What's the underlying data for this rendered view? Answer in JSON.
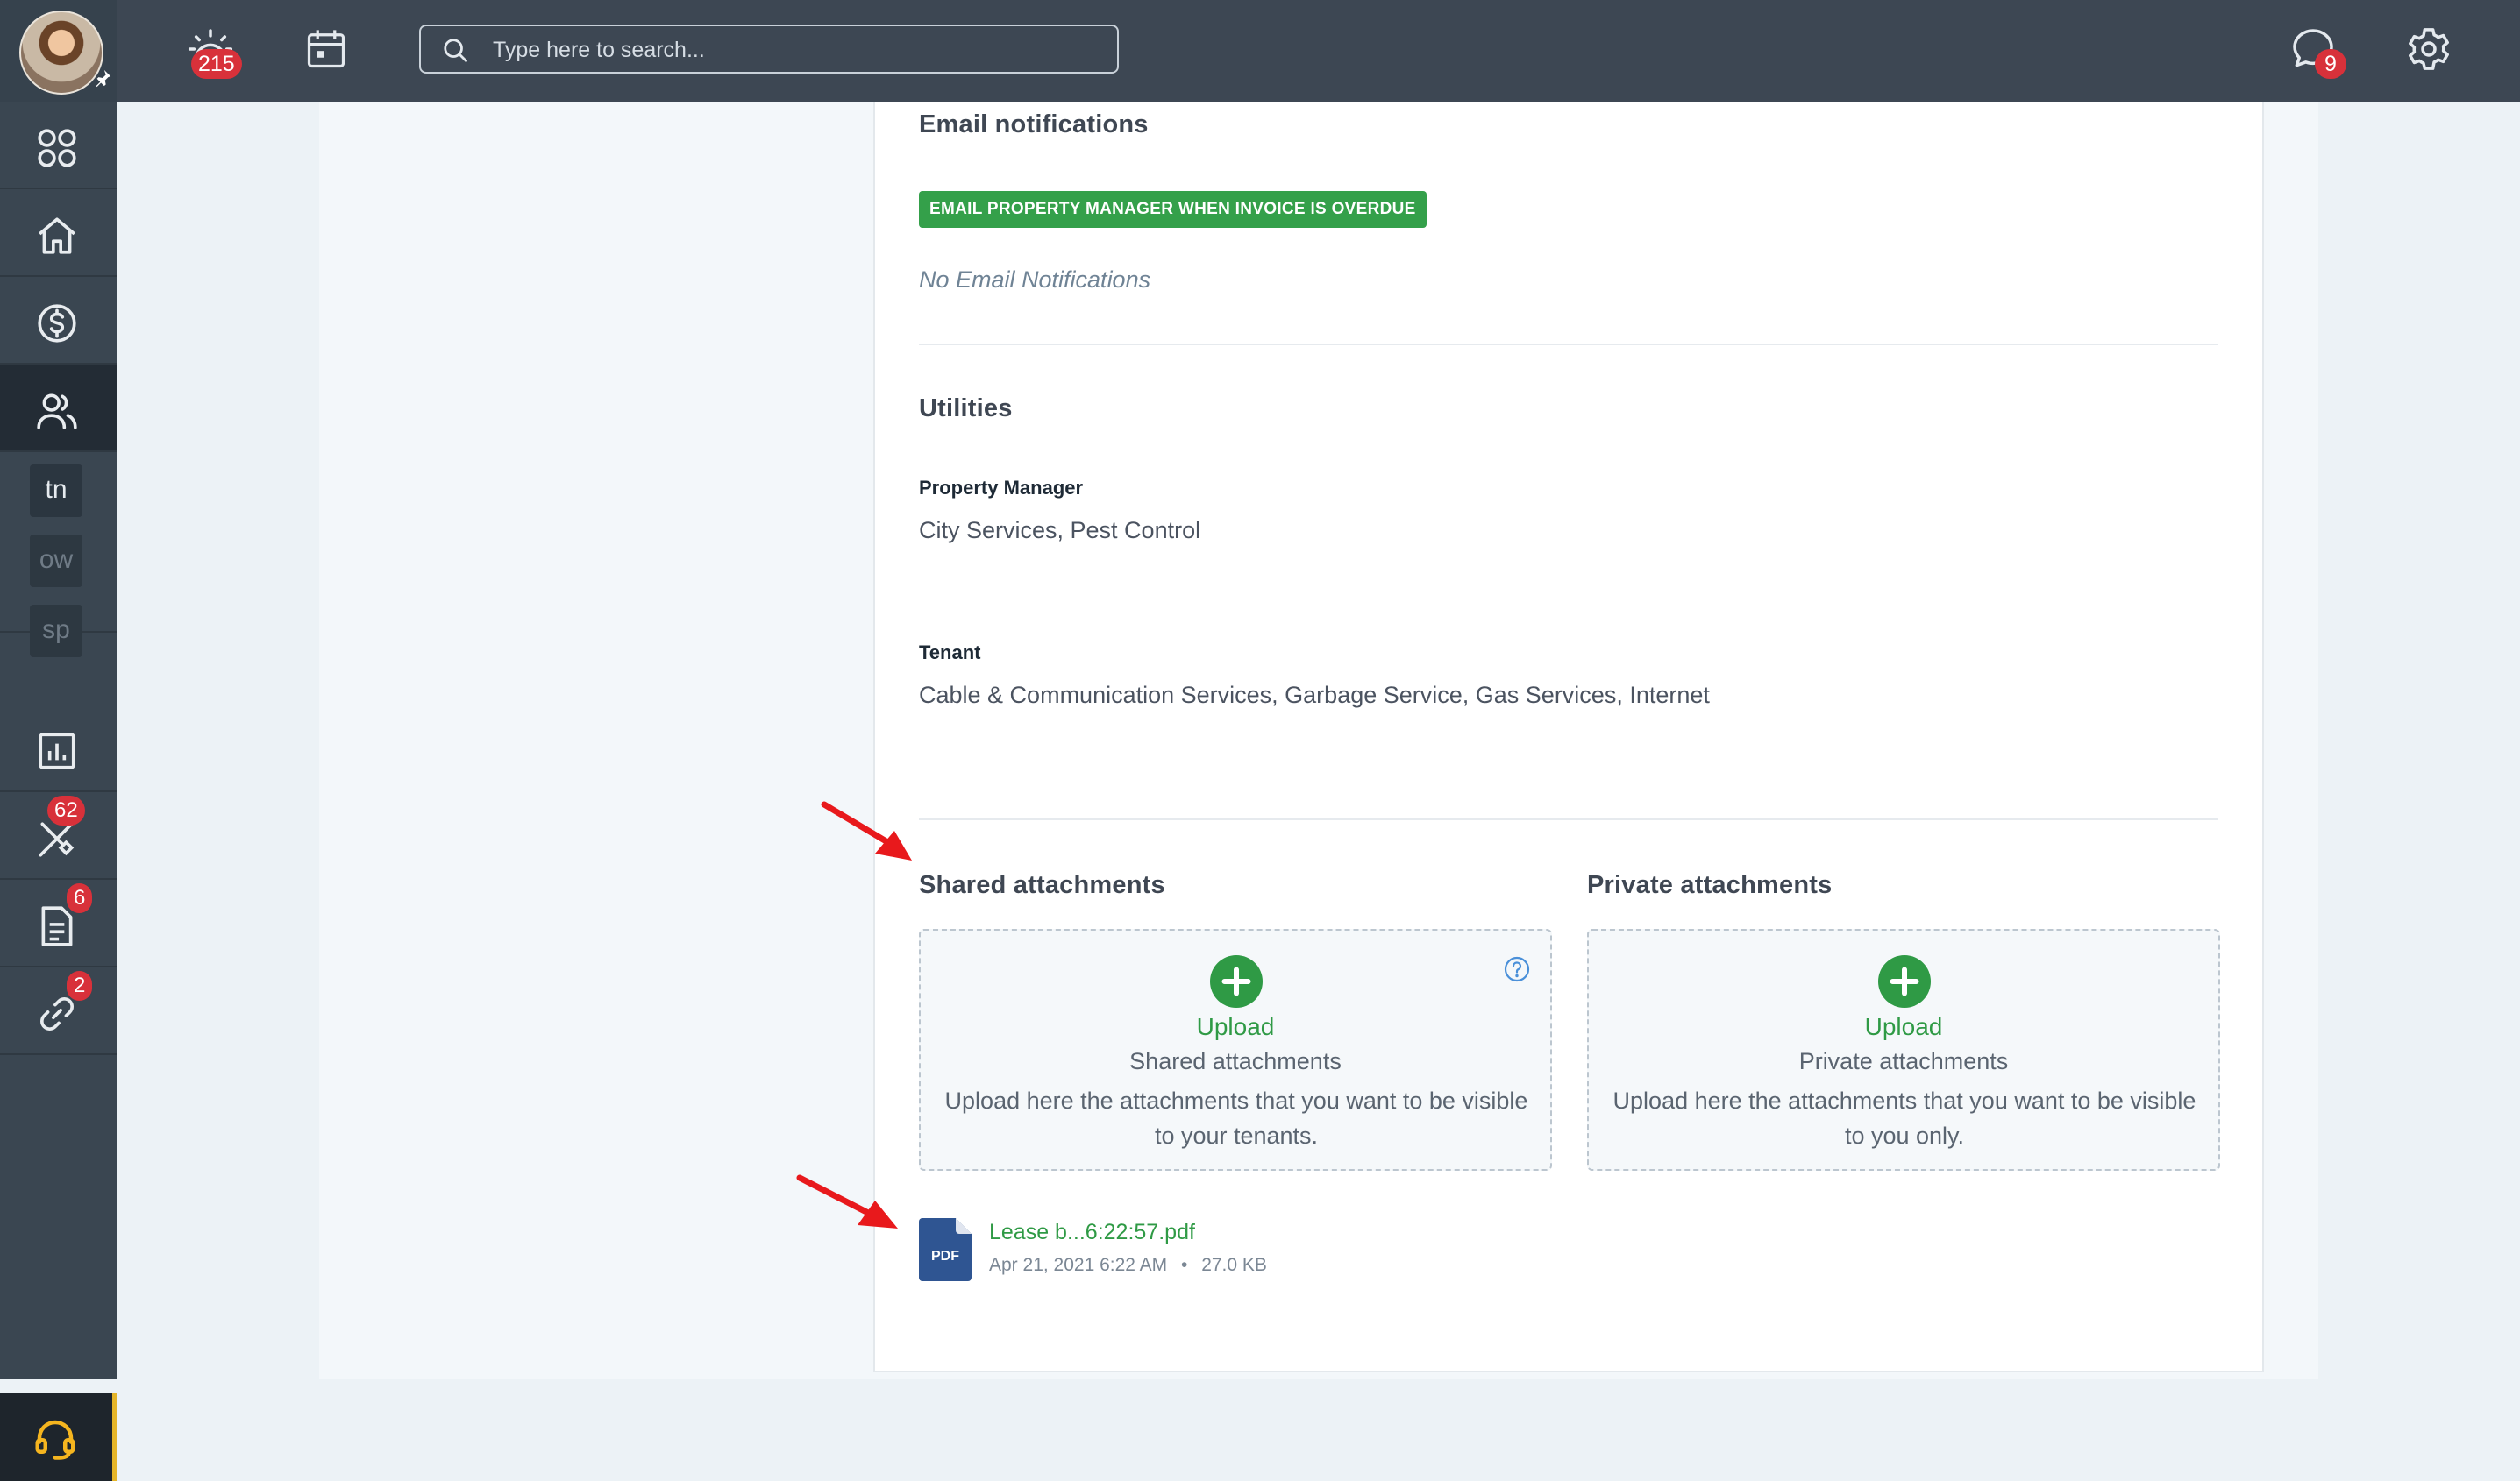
{
  "topbar": {
    "notifications_count": "215",
    "messages_count": "9",
    "search_placeholder": "Type here to search..."
  },
  "sidebar": {
    "abbrs": [
      "tn",
      "ow",
      "sp"
    ],
    "badges": {
      "tools": "62",
      "documents": "6",
      "links": "2"
    }
  },
  "email": {
    "heading": "Email notifications",
    "chip": "EMAIL PROPERTY MANAGER WHEN INVOICE IS OVERDUE",
    "empty": "No Email Notifications"
  },
  "utilities": {
    "heading": "Utilities",
    "pm_label": "Property Manager",
    "pm_value": "City Services, Pest Control",
    "tenant_label": "Tenant",
    "tenant_value": "Cable & Communication Services, Garbage Service, Gas Services, Internet"
  },
  "attachments": {
    "shared": {
      "heading": "Shared attachments",
      "upload": "Upload",
      "title": "Shared attachments",
      "desc": "Upload here the attachments that you want to be visible to your tenants."
    },
    "private": {
      "heading": "Private attachments",
      "upload": "Upload",
      "title": "Private attachments",
      "desc": "Upload here the attachments that you want to be visible to you only."
    },
    "file": {
      "icon_label": "PDF",
      "name": "Lease b...6:22:57.pdf",
      "date": "Apr 21, 2021 6:22 AM",
      "separator": "•",
      "size": "27.0 KB"
    }
  },
  "colors": {
    "topbar": "#3d4753",
    "sidebar": "#3a4651",
    "accent_green": "#34a04a",
    "badge_red": "#d8313a",
    "support_yellow": "#f5b51f",
    "arrow_red": "#e8191c"
  }
}
